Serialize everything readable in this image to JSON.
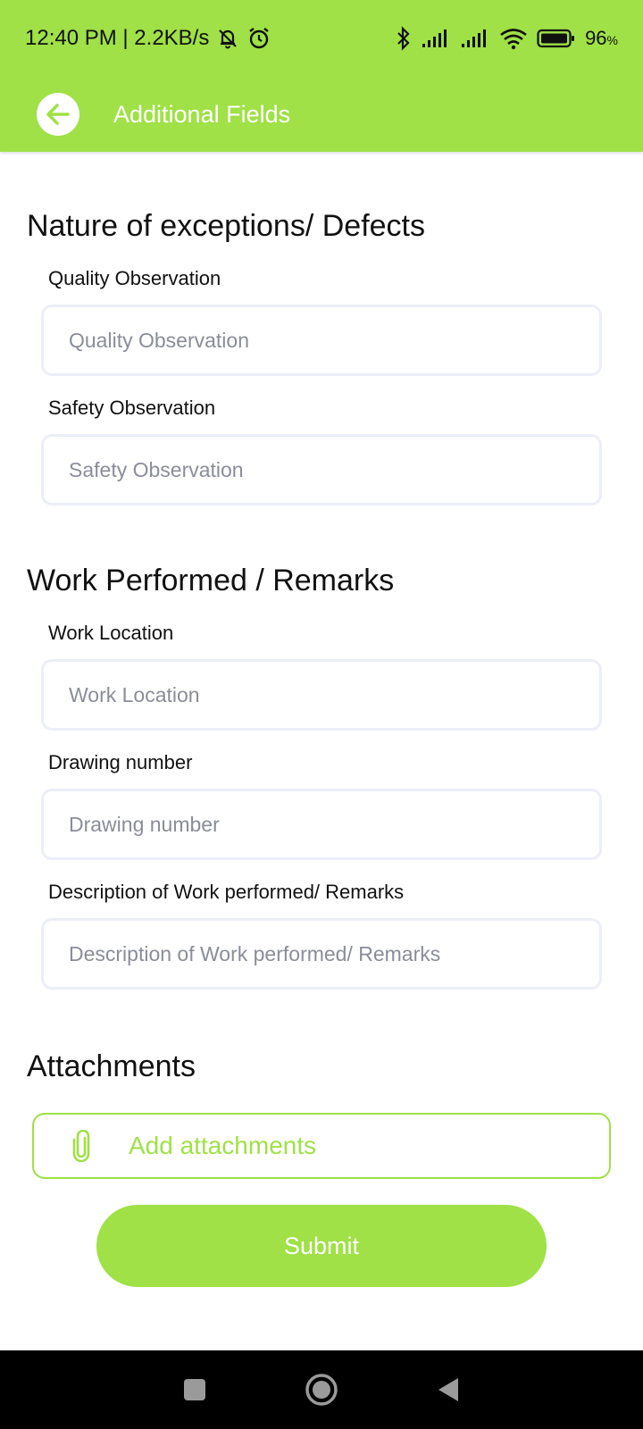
{
  "status_bar": {
    "time_speed": "12:40 PM | 2.2KB/s",
    "battery_level": "96",
    "battery_unit": "%",
    "icons": [
      "mute-bell-icon",
      "alarm-icon",
      "bluetooth-icon",
      "signal-icon",
      "signal-icon",
      "wifi-icon",
      "battery-icon"
    ]
  },
  "app_bar": {
    "title": "Additional Fields",
    "back_icon": "arrow-left-icon"
  },
  "sections": {
    "nature": {
      "title": "Nature of exceptions/ Defects",
      "quality_label": "Quality Observation",
      "quality_placeholder": "Quality Observation",
      "safety_label": "Safety Observation",
      "safety_placeholder": "Safety Observation"
    },
    "work": {
      "title": "Work Performed / Remarks",
      "location_label": "Work Location",
      "location_placeholder": "Work Location",
      "drawing_label": "Drawing number",
      "drawing_placeholder": "Drawing number",
      "description_label": "Description of Work performed/ Remarks",
      "description_placeholder": "Description of Work performed/ Remarks"
    },
    "attachments": {
      "title": "Attachments",
      "add_label": "Add attachments",
      "icon": "paperclip-icon"
    }
  },
  "submit_label": "Submit",
  "nav_bar": {
    "icons": [
      "square-icon",
      "circle-icon",
      "triangle-back-icon"
    ]
  },
  "colors": {
    "accent": "#9fe146",
    "input_border": "#eceef8",
    "placeholder": "#8a8d99"
  }
}
